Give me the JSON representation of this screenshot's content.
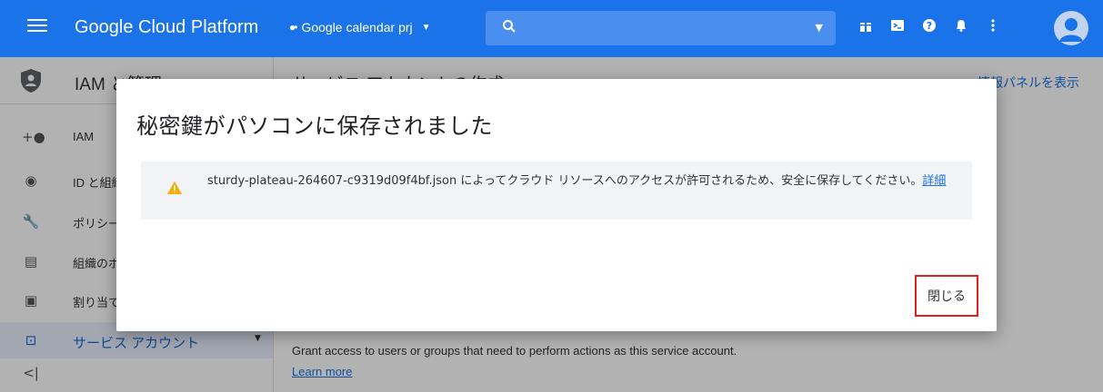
{
  "topbar": {
    "brand": "Google Cloud Platform",
    "project": "Google calendar prj",
    "accent": "#1a73e8"
  },
  "sidebar": {
    "title": "IAM と管理",
    "items": [
      {
        "label": "IAM",
        "icon": "add-person-icon"
      },
      {
        "label": "ID と組織",
        "icon": "account-circle-icon"
      },
      {
        "label": "ポリシー",
        "icon": "wrench-icon"
      },
      {
        "label": "組織のポリシー",
        "icon": "article-icon"
      },
      {
        "label": "割り当て",
        "icon": "quota-icon"
      },
      {
        "label": "サービス アカウント",
        "icon": "service-account-icon"
      }
    ],
    "collapse_icon": "collapse-icon"
  },
  "main": {
    "title": "サービス アカウントの作成",
    "info_panel": "情報パネルを表示",
    "grant_text": "Grant access to users or groups that need to perform actions as this service account.",
    "learn_more": "Learn more"
  },
  "dialog": {
    "title": "秘密鍵がパソコンに保存されました",
    "message": "sturdy-plateau-264607-c9319d09f4bf.json によってクラウド リソースへのアクセスが許可されるため、安全に保存してください。",
    "details_link": "詳細",
    "close_label": "閉じる",
    "highlight": "#e0201b"
  }
}
